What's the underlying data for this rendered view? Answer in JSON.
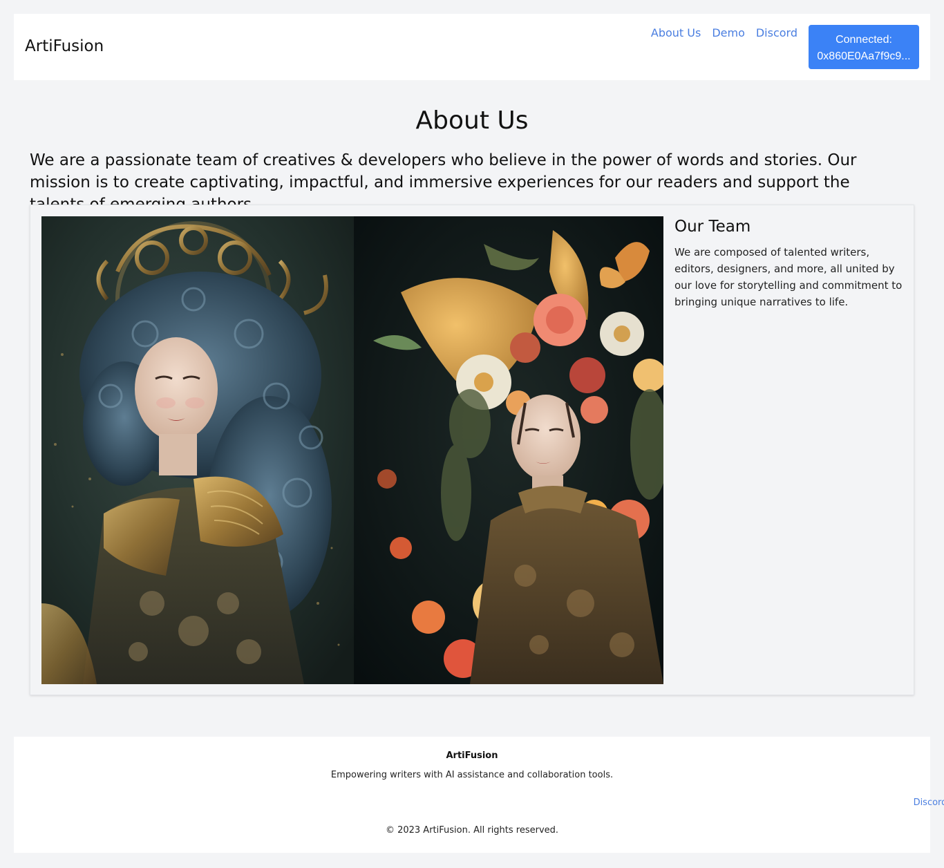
{
  "header": {
    "brand": "ArtiFusion",
    "nav": [
      {
        "label": "About Us"
      },
      {
        "label": "Demo"
      },
      {
        "label": "Discord"
      }
    ],
    "wallet": {
      "status": "Connected:",
      "address": "0x860E0Aa7f9c9..."
    }
  },
  "main": {
    "title": "About Us",
    "intro": "We are a passionate team of creatives & developers who believe in the power of words and stories. Our mission is to create captivating, impactful, and immersive experiences for our readers and support the talents of emerging authors.",
    "team": {
      "title": "Our Team",
      "text": "We are composed of talented writers, editors, designers, and more, all united by our love for storytelling and commitment to bringing unique narratives to life."
    }
  },
  "footer": {
    "brand": "ArtiFusion",
    "tagline": "Empowering writers with AI assistance and collaboration tools.",
    "link": "Discord",
    "copyright": "© 2023 ArtiFusion. All rights reserved."
  },
  "colors": {
    "accent": "#3b82f6",
    "link": "#4a7ee0",
    "background": "#f3f4f6"
  }
}
